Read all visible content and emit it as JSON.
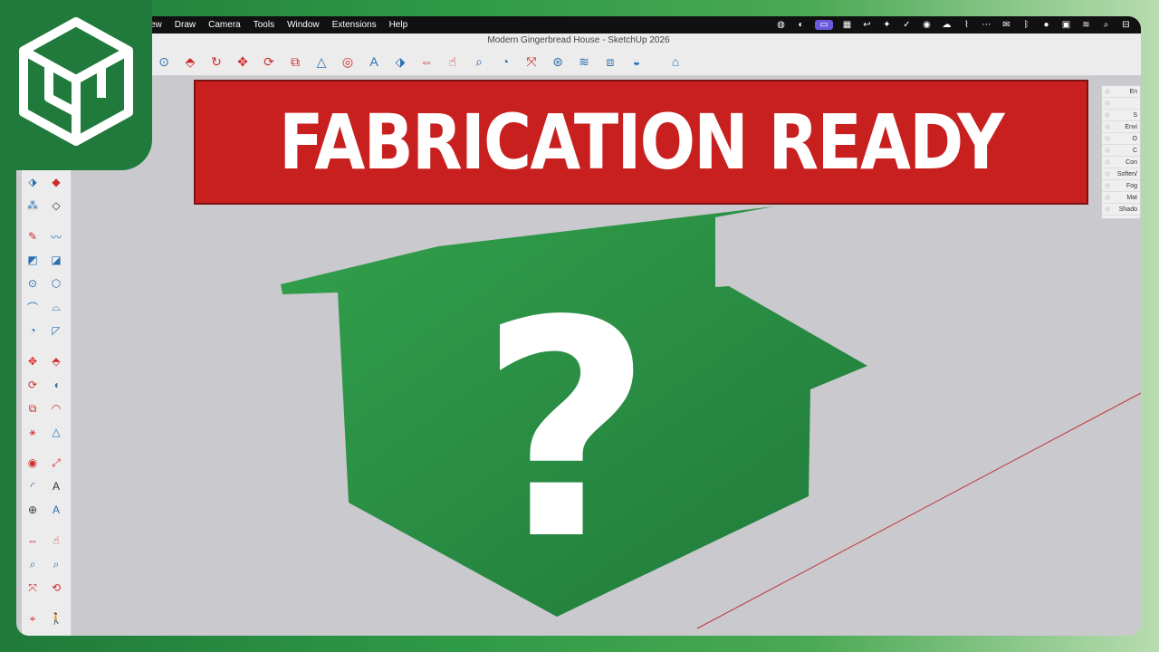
{
  "window": {
    "title": "Modern Gingerbread House - SketchUp 2026"
  },
  "menubar": {
    "items": [
      "ew",
      "Draw",
      "Camera",
      "Tools",
      "Window",
      "Extensions",
      "Help"
    ]
  },
  "banner": {
    "text": "FABRICATION READY"
  },
  "overlay": {
    "symbol": "?"
  },
  "tray": {
    "items": [
      "En",
      "",
      "S",
      "Envi",
      "O",
      "C",
      "Con",
      "Soften/",
      "Fog",
      "Mat",
      "Shado"
    ]
  },
  "colors": {
    "brand_green": "#207a3b",
    "banner_red": "#c8201f",
    "house_green": "#2c8e45",
    "axis_red": "#c0383c"
  },
  "icons": {
    "app_logo": "sketchup-logo-icon"
  }
}
